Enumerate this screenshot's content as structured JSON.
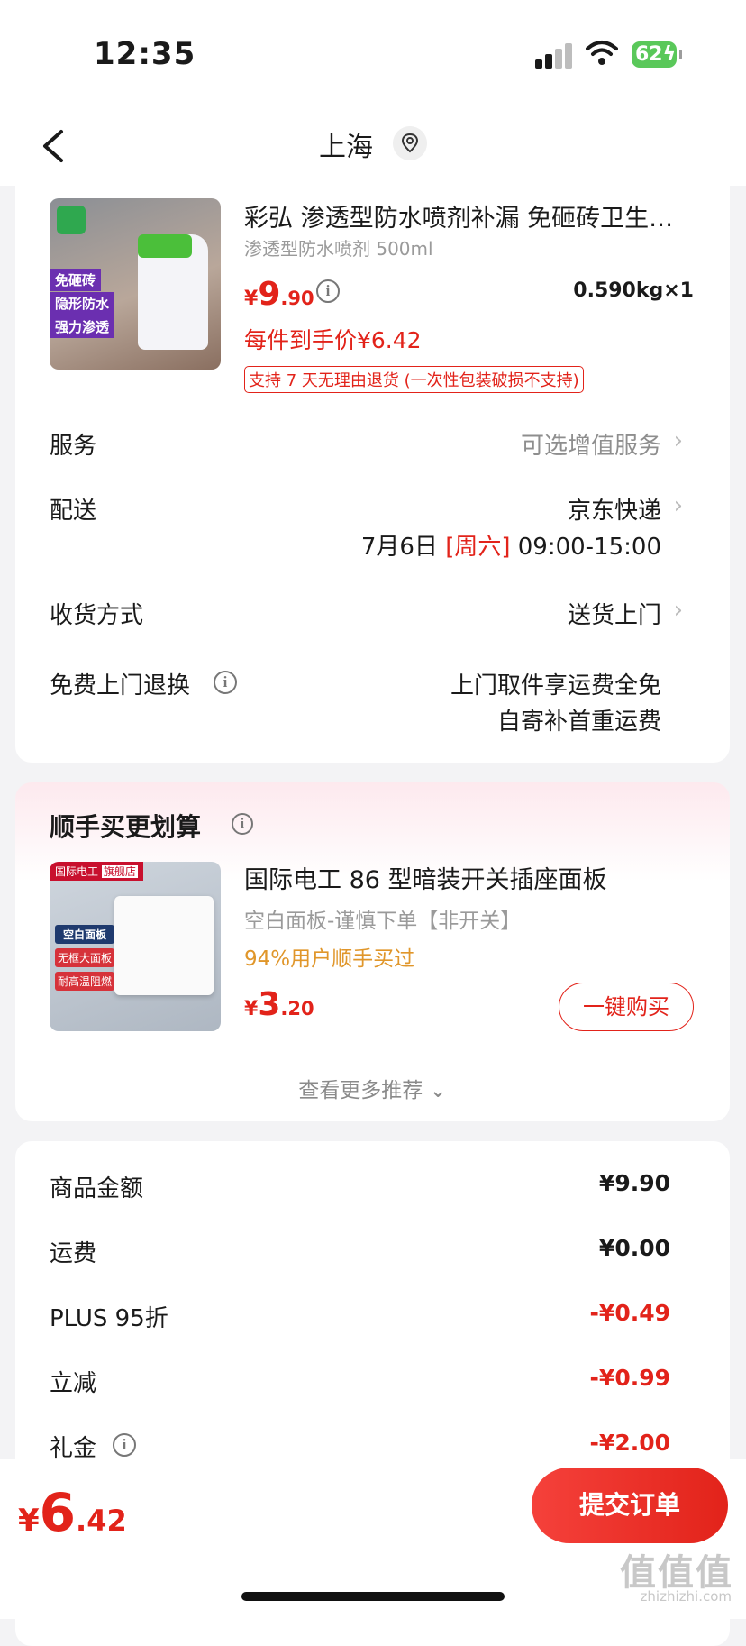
{
  "status_bar": {
    "time": "12:35",
    "battery": "62"
  },
  "nav": {
    "city": "上海"
  },
  "product": {
    "title": "彩弘 渗透型防水喷剂补漏 免砸砖卫生…",
    "spec": "渗透型防水喷剂 500ml",
    "price_symbol": "¥",
    "price_int": "9",
    "price_dec": ".90",
    "weight_qty": "0.590kg×1",
    "final_price": "每件到手价¥6.42",
    "return_policy": "支持 7 天无理由退货 (一次性包装破损不支持)",
    "image_tags": [
      "免砸砖",
      "隐形防水",
      "强力渗透"
    ]
  },
  "rows": {
    "service_label": "服务",
    "service_value": "可选增值服务",
    "delivery_label": "配送",
    "delivery_value": "京东快递",
    "delivery_date": "7月6日",
    "delivery_weekday": "[周六]",
    "delivery_time": "09:00-15:00",
    "receive_label": "收货方式",
    "receive_value": "送货上门",
    "free_return_label": "免费上门退换",
    "free_return_line1": "上门取件享运费全免",
    "free_return_line2": "自寄补首重运费"
  },
  "addon": {
    "section_title": "顺手买更划算",
    "title": "国际电工 86 型暗装开关插座面板",
    "spec": "空白面板-谨慎下单【非开关】",
    "bought_rate": "94%用户顺手买过",
    "price_symbol": "¥",
    "price_int": "3",
    "price_dec": ".20",
    "buy_button": "一键购买",
    "more": "查看更多推荐 ⌄",
    "image_brand": "国际电工",
    "image_store": "旗舰店",
    "image_text1": "空白面板",
    "image_text2": "无框大面板",
    "image_text3": "耐高温阻燃"
  },
  "amounts": [
    {
      "label": "商品金额",
      "value": "¥9.90",
      "red": false
    },
    {
      "label": "运费",
      "value": "¥0.00",
      "red": false
    },
    {
      "label": "PLUS 95折",
      "value": "-¥0.49",
      "red": true
    },
    {
      "label": "立减",
      "value": "-¥0.99",
      "red": true
    },
    {
      "label": "礼金",
      "value": "-¥2.00",
      "red": true
    }
  ],
  "footer": {
    "total_symbol": "¥",
    "total_int": "6",
    "total_dec": ".42",
    "submit": "提交订单",
    "watermark": "值值值",
    "watermark_url": "zhizhizhi.com"
  },
  "colors": {
    "accent_red": "#e2231a",
    "battery_green": "#5ac85a"
  }
}
